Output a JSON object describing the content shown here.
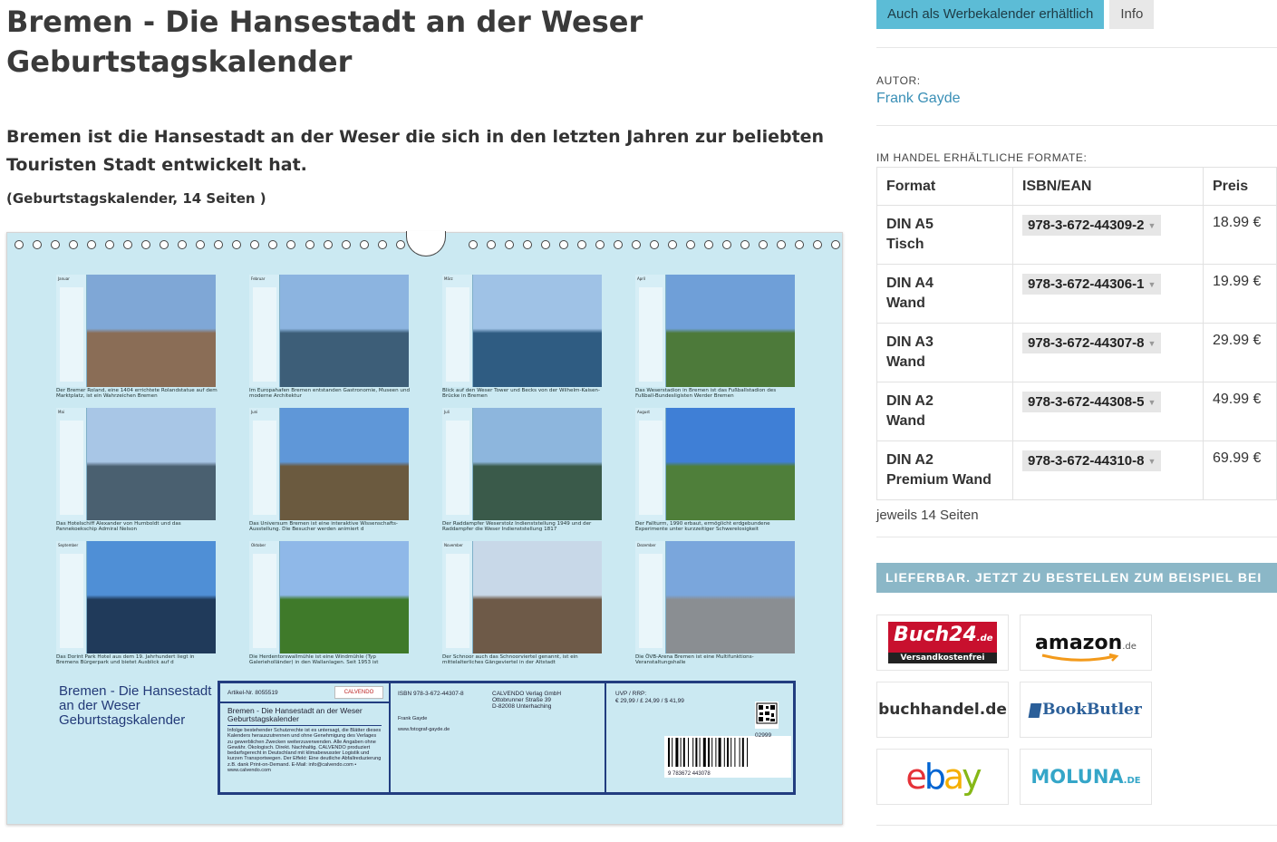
{
  "product": {
    "title_line1": "Bremen - Die Hansestadt an der Weser",
    "title_line2": "Geburtstagskalender",
    "subtitle": "Bremen ist die Hansestadt an der Weser die sich in den letzten Jahren zur beliebten Touristen Stadt entwickelt hat.",
    "meta": "(Geburtstagskalender, 14 Seiten )"
  },
  "calendar_preview": {
    "months": [
      {
        "label": "Januar",
        "caption": "Der Bremer Roland, eine 1404 errichtete Rolandstatue auf dem Marktplatz, ist ein Wahrzeichen Bremen",
        "sky": "#7fa7d6",
        "ground": "#8a6d56"
      },
      {
        "label": "Februar",
        "caption": "Im Europahafen Bremen entstanden Gastronomie, Museen und moderne Architektur",
        "sky": "#8cb4e0",
        "ground": "#3d5e78"
      },
      {
        "label": "März",
        "caption": "Blick auf den Weser Tower und Becks von der Wilhelm-Kaisen-Brücke in Bremen",
        "sky": "#9fc2e6",
        "ground": "#2f5c82"
      },
      {
        "label": "April",
        "caption": "Das Weserstadion in Bremen ist das Fußballstadion des Fußball-Bundesligisten Werder Bremen",
        "sky": "#6f9fd8",
        "ground": "#4d7a3a"
      },
      {
        "label": "Mai",
        "caption": "Das Hotelschiff Alexander von Humboldt und das Pannekoekschip Admiral Nelson",
        "sky": "#a8c6e6",
        "ground": "#4a6070"
      },
      {
        "label": "Juni",
        "caption": "Das Universum Bremen ist eine interaktive Wissenschafts-Ausstellung. Die Besucher werden animiert d",
        "sky": "#5f97d8",
        "ground": "#6b5a3f"
      },
      {
        "label": "Juli",
        "caption": "Der Raddampfer Weserstolz Indienststellung 1949 und der Raddampfer die Weser Indienststellung 1817",
        "sky": "#8db6dd",
        "ground": "#3a5a4a"
      },
      {
        "label": "August",
        "caption": "Der Fallturm, 1990 erbaut, ermöglicht erdgebundene Experimente unter kurzzeitiger Schwerelosigkeit",
        "sky": "#3f7fd6",
        "ground": "#4f7f3a"
      },
      {
        "label": "September",
        "caption": "Das Dorint Park Hotel aus dem 19. Jahrhundert liegt in Bremens Bürgerpark und bietet Ausblick auf d",
        "sky": "#4f8fd6",
        "ground": "#203a5a"
      },
      {
        "label": "Oktober",
        "caption": "Die Herdentorswallmühle ist eine Windmühle (Typ Galerieholländer) in den Wallanlagen. Seit 1953 ist",
        "sky": "#8fb8e8",
        "ground": "#3f7a2a"
      },
      {
        "label": "November",
        "caption": "Der Schnoor auch das Schnoorviertel genannt, ist ein mittelalterliches Gängeviertel in der Altstadt",
        "sky": "#c8d8e8",
        "ground": "#6e5a48"
      },
      {
        "label": "Dezember",
        "caption": "Die ÖVB-Arena Bremen ist eine Multifunktions-Veranstaltungshalle",
        "sky": "#7aa6dc",
        "ground": "#8a8e92"
      }
    ],
    "back_title": "Bremen - Die Hansestadt an der Weser Geburtstagskalender",
    "artikel": "Artikel-Nr. 8055519",
    "publisher_logo": "CALVENDO",
    "back_product": "Bremen - Die Hansestadt an der Weser Geburtstagskalender",
    "back_legal": "Infolge bestehender Schutzrechte ist es untersagt, die Blätter dieses Kalenders herauszutrennen und ohne Genehmigung des Verlages zu gewerblichen Zwecken weiterzuverwenden. Alle Angaben ohne Gewähr. Ökologisch. Direkt. Nachhaltig. CALVENDO produziert bedarfsgerecht in Deutschland mit klimabewusster Logistik und kurzen Transportwegen. Der Effekt: Eine deutliche Abfallreduzierung z.B. dank Print-on-Demand. E-Mail: info@calvendo.com • www.calvendo.com",
    "isbn_print": "ISBN 978-3-672-44307-8",
    "author_print": "Frank Gayde",
    "website": "www.fotograf-gayde.de",
    "publisher_address": [
      "CALVENDO Verlag GmbH",
      "Ottobrunner Straße 39",
      "D-82008 Unterhaching"
    ],
    "uvp_label": "UVP / RRP:",
    "uvp_values": "€ 29,99 / £ 24,99 / $ 41,99",
    "barcode_number": "9 783672 443078",
    "barcode_addon": "02999"
  },
  "sidebar": {
    "btn_werbe": "Auch als Werbekalender erhältlich",
    "btn_info": "Info",
    "autor_label": "AUTOR:",
    "autor_name": "Frank Gayde",
    "formats_label": "IM HANDEL ERHÄLTLICHE FORMATE:",
    "table_headers": [
      "Format",
      "ISBN/EAN",
      "Preis"
    ],
    "formats": [
      {
        "line1": "DIN A5",
        "line2": "Tisch",
        "isbn": "978-3-672-44309-2",
        "price": "18.99 €"
      },
      {
        "line1": "DIN A4",
        "line2": "Wand",
        "isbn": "978-3-672-44306-1",
        "price": "19.99 €"
      },
      {
        "line1": "DIN A3",
        "line2": "Wand",
        "isbn": "978-3-672-44307-8",
        "price": "29.99 €"
      },
      {
        "line1": "DIN A2",
        "line2": "Wand",
        "isbn": "978-3-672-44308-5",
        "price": "49.99 €"
      },
      {
        "line1": "DIN A2",
        "line2": "Premium Wand",
        "isbn": "978-3-672-44310-8",
        "price": "69.99 €"
      }
    ],
    "pages_note": "jeweils 14 Seiten",
    "lieferbar": "LIEFERBAR. JETZT ZU BESTELLEN ZUM BEISPIEL BEI",
    "shops": {
      "buch24_main": "Buch24",
      "buch24_tld": ".de",
      "buch24_tag": "Versandkostenfrei",
      "amazon": "amazon",
      "amazon_tld": ".de",
      "buchhandel": "buchhandel.de",
      "bookbutler": "BookButler",
      "ebay": [
        "e",
        "b",
        "a",
        "y"
      ],
      "moluna": "MOLUNA",
      "moluna_tld": ".DE"
    }
  },
  "colors": {
    "accent": "#5cbcd6",
    "link": "#3a8fb6",
    "calendar_bg": "#cbe9f2",
    "back_border": "#223d80"
  }
}
